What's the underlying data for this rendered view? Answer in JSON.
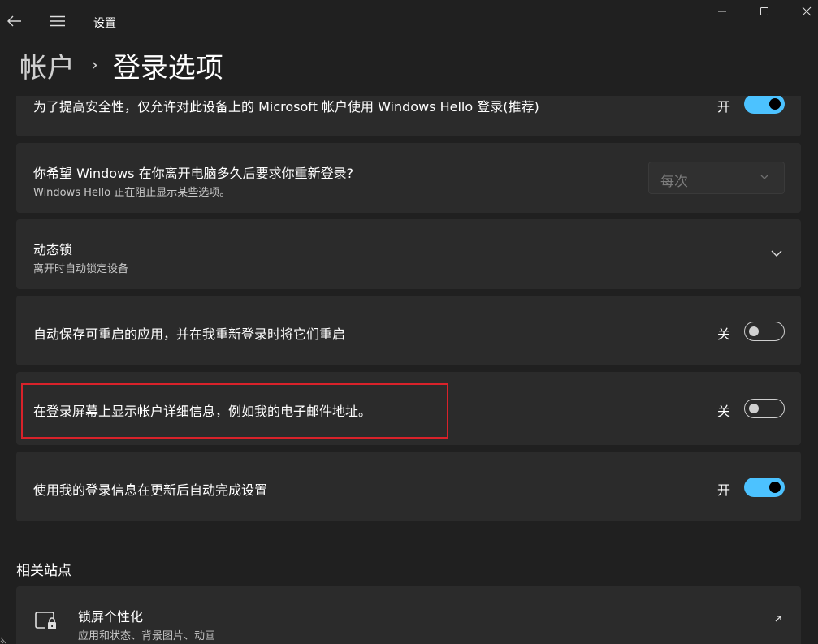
{
  "window": {
    "app_title": "设置"
  },
  "breadcrumb": {
    "parent": "帐户",
    "separator": "›",
    "current": "登录选项"
  },
  "settings": {
    "windows_hello_only": {
      "title": "为了提高安全性，仅允许对此设备上的 Microsoft 帐户使用 Windows Hello 登录(推荐)",
      "state_label": "开",
      "state": "on"
    },
    "relogin_timeout": {
      "title": "你希望 Windows 在你离开电脑多久后要求你重新登录?",
      "subtitle": "Windows Hello 正在阻止显示某些选项。",
      "selected": "每次",
      "disabled": true
    },
    "dynamic_lock": {
      "title": "动态锁",
      "subtitle": "离开时自动锁定设备"
    },
    "restart_apps": {
      "title": "自动保存可重启的应用，并在我重新登录时将它们重启",
      "state_label": "关",
      "state": "off"
    },
    "show_account_details": {
      "title": "在登录屏幕上显示帐户详细信息，例如我的电子邮件地址。",
      "state_label": "关",
      "state": "off"
    },
    "use_signin_info": {
      "title": "使用我的登录信息在更新后自动完成设置",
      "state_label": "开",
      "state": "on"
    }
  },
  "related": {
    "section_title": "相关站点",
    "lock_screen": {
      "title": "锁屏个性化",
      "subtitle": "应用和状态、背景图片、动画"
    }
  },
  "colors": {
    "accent": "#4cc2ff",
    "background": "#202020",
    "card": "#2b2b2b",
    "highlight": "#d9222a"
  }
}
